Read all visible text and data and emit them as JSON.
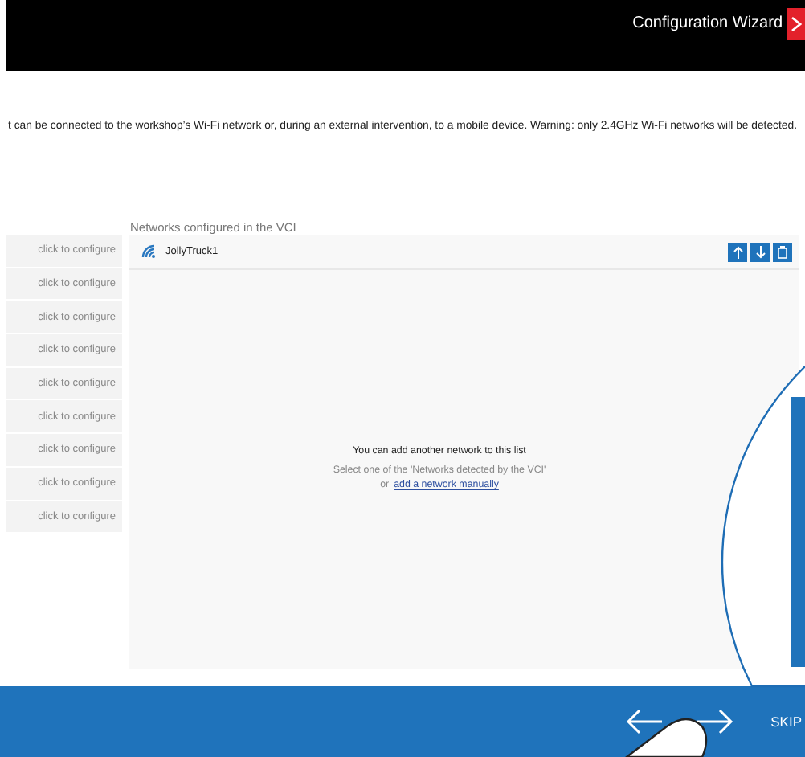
{
  "window": {
    "title": "Configuration Wizard"
  },
  "description": "t can be connected to the workshop’s Wi-Fi network or, during an external intervention, to a mobile device. Warning: only 2.4GHz Wi-Fi networks will be detected.",
  "detected_list": {
    "items": [
      {
        "label": "click to configure"
      },
      {
        "label": "click to configure"
      },
      {
        "label": "click to configure"
      },
      {
        "label": "click to configure"
      },
      {
        "label": "click to configure"
      },
      {
        "label": "click to configure"
      },
      {
        "label": "click to configure"
      },
      {
        "label": "click to configure"
      },
      {
        "label": "click to configure"
      }
    ]
  },
  "configured_networks": {
    "title": "Networks configured in the VCI",
    "items": [
      {
        "name": "JollyTruck1"
      }
    ],
    "empty_message": "You can add another network to this list",
    "hint": "Select one of the 'Networks detected by the VCI'",
    "hint_or": "or",
    "add_link": "add a network manually"
  },
  "footer": {
    "skip": "SKIP"
  }
}
